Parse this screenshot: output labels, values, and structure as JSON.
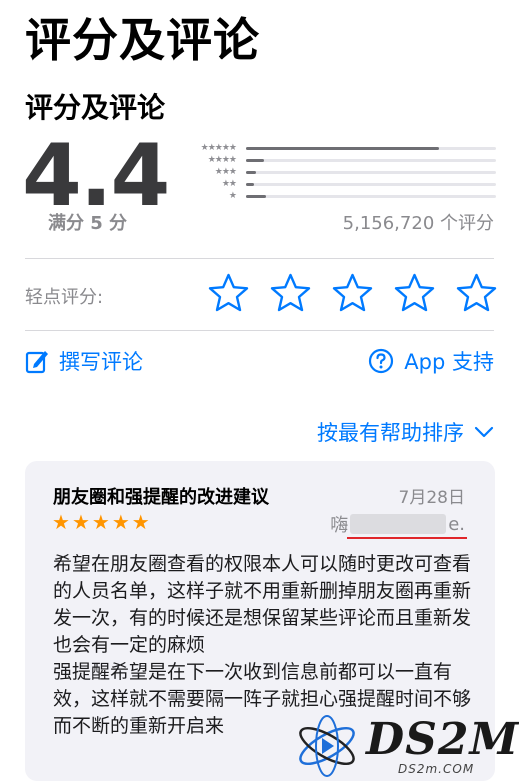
{
  "header": {
    "title": "评分及评论"
  },
  "ratings": {
    "section_title": "评分及评论",
    "score": "4.4",
    "out_of": "满分 5 分",
    "count_text": "5,156,720 个评分",
    "histogram": [
      {
        "stars": "★★★★★",
        "fraction": 0.77
      },
      {
        "stars": "★★★★",
        "fraction": 0.07
      },
      {
        "stars": "★★★",
        "fraction": 0.04
      },
      {
        "stars": "★★",
        "fraction": 0.03
      },
      {
        "stars": "★",
        "fraction": 0.08
      }
    ]
  },
  "tap_to_rate": {
    "label": "轻点评分:",
    "star_count": 5
  },
  "actions": {
    "write_review": "撰写评论",
    "app_support": "App 支持"
  },
  "sort": {
    "label": "按最有帮助排序"
  },
  "review": {
    "title": "朋友圈和强提醒的改进建议",
    "date": "7月28日",
    "rating": 5,
    "author_prefix": "嗨",
    "author_suffix": "e.",
    "body_p1": "希望在朋友圈查看的权限本人可以随时更改可查看的人员名单，这样子就不用重新删掉朋友圈再重新发一次，有的时候还是想保留某些评论而且重新发也会有一定的麻烦",
    "body_p2": "强提醒希望是在下一次收到信息前都可以一直有效，这样就不需要隔一阵子就担心强提醒时间不够而不断的重新开启来"
  },
  "watermark": {
    "text": "DS2M",
    "url": "DS2m.COM"
  },
  "colors": {
    "accent": "#007aff",
    "star": "#ff9500",
    "underline": "#e0262b"
  }
}
